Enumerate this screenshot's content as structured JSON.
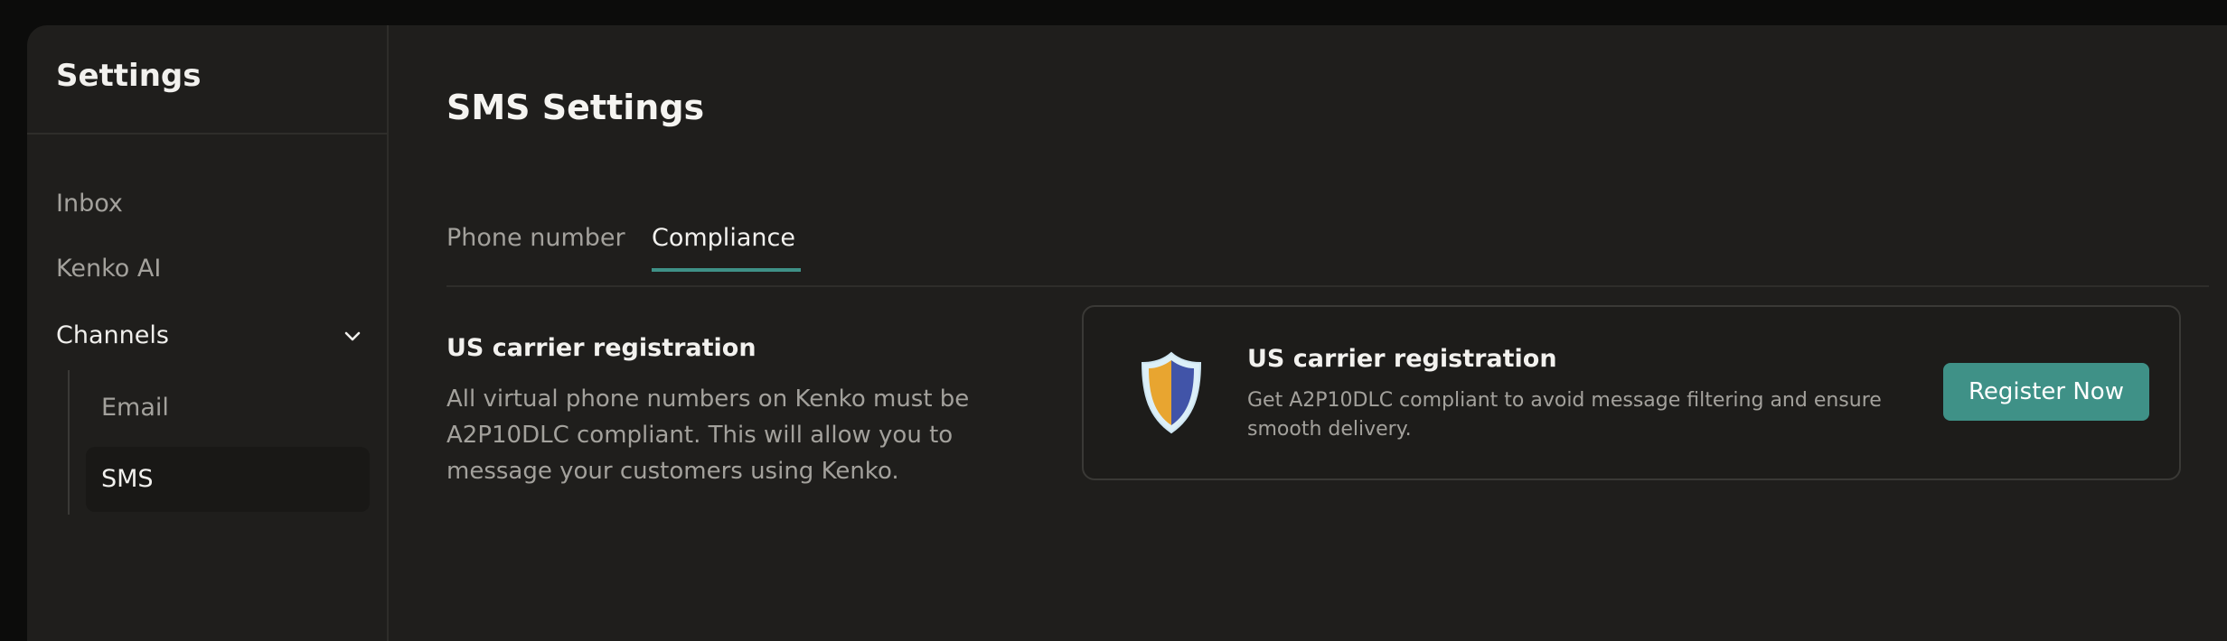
{
  "sidebar": {
    "title": "Settings",
    "items": [
      {
        "label": "Inbox"
      },
      {
        "label": "Kenko AI"
      },
      {
        "label": "Channels"
      }
    ],
    "channels": [
      {
        "label": "Email"
      },
      {
        "label": "SMS"
      }
    ]
  },
  "main": {
    "title": "SMS Settings",
    "tabs": [
      {
        "label": "Phone number"
      },
      {
        "label": "Compliance"
      }
    ],
    "active_tab": "Compliance",
    "section": {
      "title": "US carrier registration",
      "description": "All virtual phone numbers on Kenko must be A2P10DLC compliant. This will allow you to message your customers using Kenko."
    },
    "card": {
      "icon": "shield-icon",
      "title": "US carrier registration",
      "description": "Get A2P10DLC compliant to avoid message filtering and ensure smooth delivery.",
      "button_label": "Register Now"
    }
  },
  "colors": {
    "accent": "#3f9187",
    "background": "#1f1e1c",
    "shield_gold": "#e8a530",
    "shield_blue": "#4154a8"
  }
}
